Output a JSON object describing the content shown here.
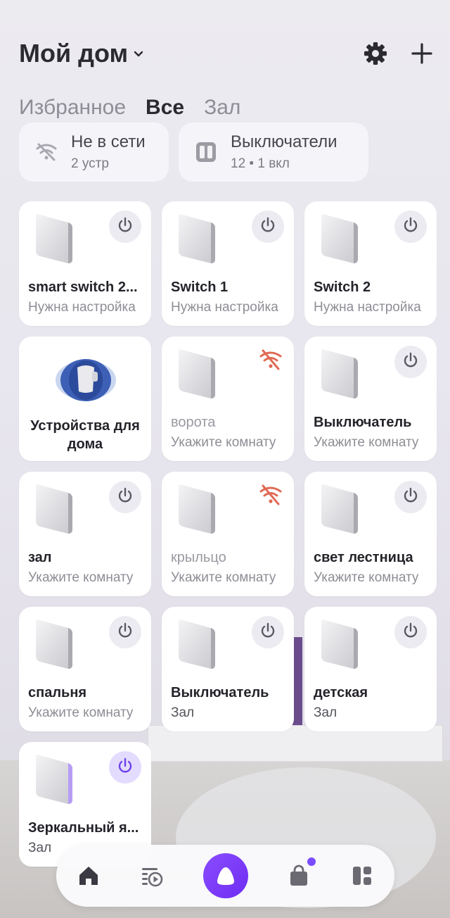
{
  "header": {
    "title": "Мой дом"
  },
  "tabs": [
    {
      "label": "Избранное",
      "active": false
    },
    {
      "label": "Все",
      "active": true
    },
    {
      "label": "Зал",
      "active": false
    }
  ],
  "chips": [
    {
      "title": "Не в сети",
      "subtitle": "2 устр",
      "icon": "wifi-off-icon"
    },
    {
      "title": "Выключатели",
      "subtitle": "12 • 1 вкл",
      "icon": "switch-icon"
    }
  ],
  "devices": [
    {
      "name": "smart switch 2...",
      "room": "Нужна настройка",
      "state": "power-off"
    },
    {
      "name": "Switch 1",
      "room": "Нужна настройка",
      "state": "power-off"
    },
    {
      "name": "Switch 2",
      "room": "Нужна настройка",
      "state": "power-off"
    },
    {
      "name": "Устройства для дома",
      "room": "",
      "state": "special"
    },
    {
      "name": "ворота",
      "room": "Укажите комнату",
      "state": "offline"
    },
    {
      "name": "Выключатель",
      "room": "Укажите комнату",
      "state": "power-off"
    },
    {
      "name": "зал",
      "room": "Укажите комнату",
      "state": "power-off"
    },
    {
      "name": "крыльцо",
      "room": "Укажите комнату",
      "state": "offline"
    },
    {
      "name": "свет лестница",
      "room": "Укажите комнату",
      "state": "power-off"
    },
    {
      "name": "спальня",
      "room": "Укажите комнату",
      "state": "power-off"
    },
    {
      "name": "Выключатель",
      "room": "Зал",
      "state": "power-off"
    },
    {
      "name": "детская",
      "room": "Зал",
      "state": "power-off"
    },
    {
      "name": "Зеркальный я...",
      "room": "Зал",
      "state": "power-on"
    }
  ],
  "nav": [
    {
      "icon": "home-icon"
    },
    {
      "icon": "media-icon"
    },
    {
      "icon": "alice-icon"
    },
    {
      "icon": "shop-icon",
      "badge": true
    },
    {
      "icon": "services-icon"
    }
  ],
  "colors": {
    "accent": "#7a4cff",
    "offline": "#e06a55",
    "power_on_bg": "#e3dcff"
  }
}
